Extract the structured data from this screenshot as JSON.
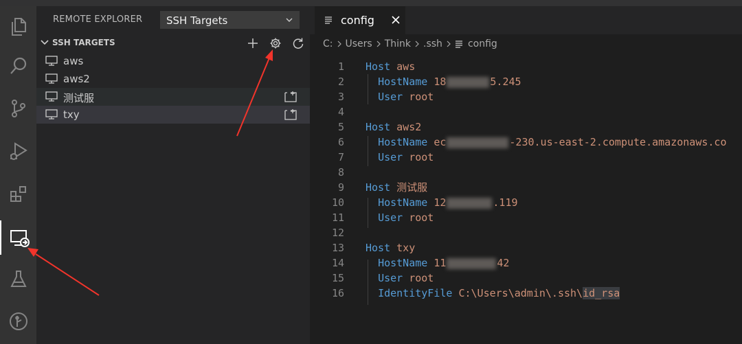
{
  "sidebar": {
    "title": "REMOTE EXPLORER",
    "select_value": "SSH Targets",
    "section_title": "SSH TARGETS",
    "items": [
      {
        "label": "aws"
      },
      {
        "label": "aws2"
      },
      {
        "label": "测试服"
      },
      {
        "label": "txy"
      }
    ]
  },
  "editor": {
    "tab_label": "config",
    "breadcrumb": [
      "C:",
      "Users",
      "Think",
      ".ssh",
      "config"
    ],
    "lines": [
      {
        "n": "1",
        "kw": "Host",
        "val": "aws"
      },
      {
        "n": "2",
        "kw": "HostName",
        "val_pre": "18",
        "val_post": "5.245"
      },
      {
        "n": "3",
        "kw": "User",
        "val": "root"
      },
      {
        "n": "4"
      },
      {
        "n": "5",
        "kw": "Host",
        "val": "aws2"
      },
      {
        "n": "6",
        "kw": "HostName",
        "val_pre": "ec",
        "val_post": "-230.us-east-2.compute.amazonaws.co"
      },
      {
        "n": "7",
        "kw": "User",
        "val": "root"
      },
      {
        "n": "8"
      },
      {
        "n": "9",
        "kw": "Host",
        "val": "测试服"
      },
      {
        "n": "10",
        "kw": "HostName",
        "val_pre": "12",
        "val_post": ".119"
      },
      {
        "n": "11",
        "kw": "User",
        "val": "root"
      },
      {
        "n": "12"
      },
      {
        "n": "13",
        "kw": "Host",
        "val": "txy"
      },
      {
        "n": "14",
        "kw": "HostName",
        "val_pre": "11",
        "val_post": "42"
      },
      {
        "n": "15",
        "kw": "User",
        "val": "root"
      },
      {
        "n": "16",
        "kw": "IdentityFile",
        "val_pre": "C:\\Users\\admin\\.ssh\\",
        "val_sel": "id_rsa"
      }
    ]
  },
  "icons": {
    "activity_bar": [
      "files-icon",
      "search-icon",
      "source-control-icon",
      "run-debug-icon",
      "extensions-icon",
      "remote-explorer-icon",
      "testing-icon",
      "git-graph-icon"
    ],
    "section_actions": [
      "add-icon",
      "gear-icon",
      "refresh-icon"
    ]
  },
  "colors": {
    "annotation_arrow": "#f2342b",
    "keyword": "#569cd6",
    "value": "#ce9178"
  }
}
